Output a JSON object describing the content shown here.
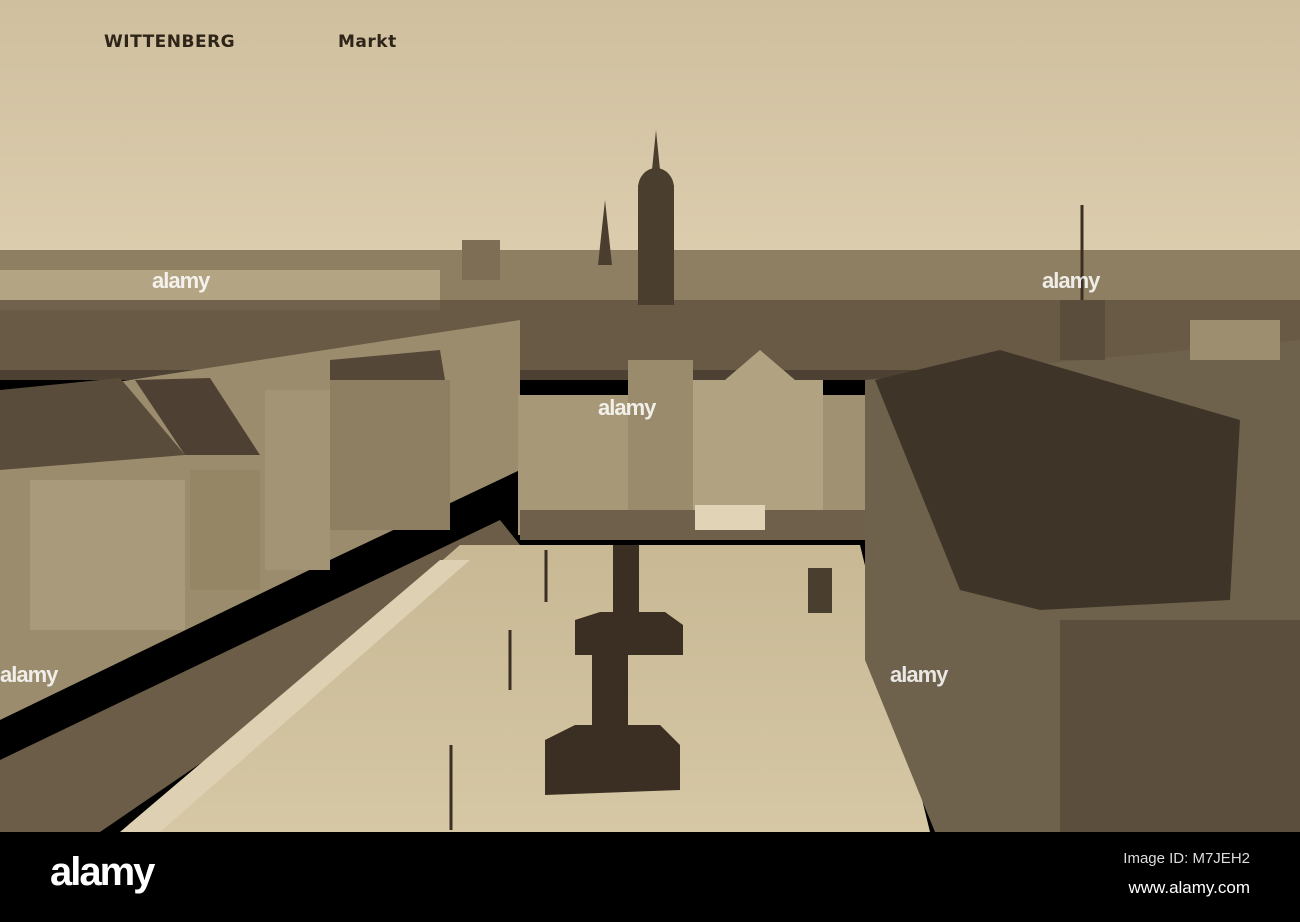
{
  "postcard": {
    "city": "WITTENBERG",
    "place": "Markt"
  },
  "watermark": {
    "text": "alamy",
    "logo": "alamy",
    "image_id": "Image ID: M7JEH2",
    "site": "www.alamy.com"
  },
  "colors": {
    "sepia_light": "#d8c9a8",
    "sepia_dark": "#3a2f22",
    "footer": "#000000"
  }
}
